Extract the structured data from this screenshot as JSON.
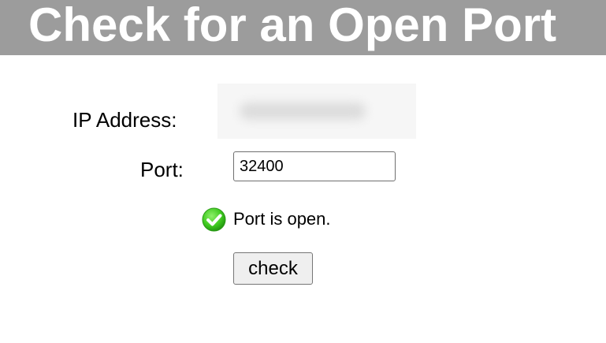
{
  "header": {
    "title": "Check for an Open Port",
    "background_color": "#9c9c9c"
  },
  "form": {
    "ip_label": "IP Address:",
    "ip_value_state": "blurred (redacted)",
    "port_label": "Port:",
    "port_value": "32400"
  },
  "status": {
    "icon": "green-checkmark-icon",
    "icon_color": "#3fca1f",
    "text": "Port is open."
  },
  "actions": {
    "check_label": "check"
  }
}
